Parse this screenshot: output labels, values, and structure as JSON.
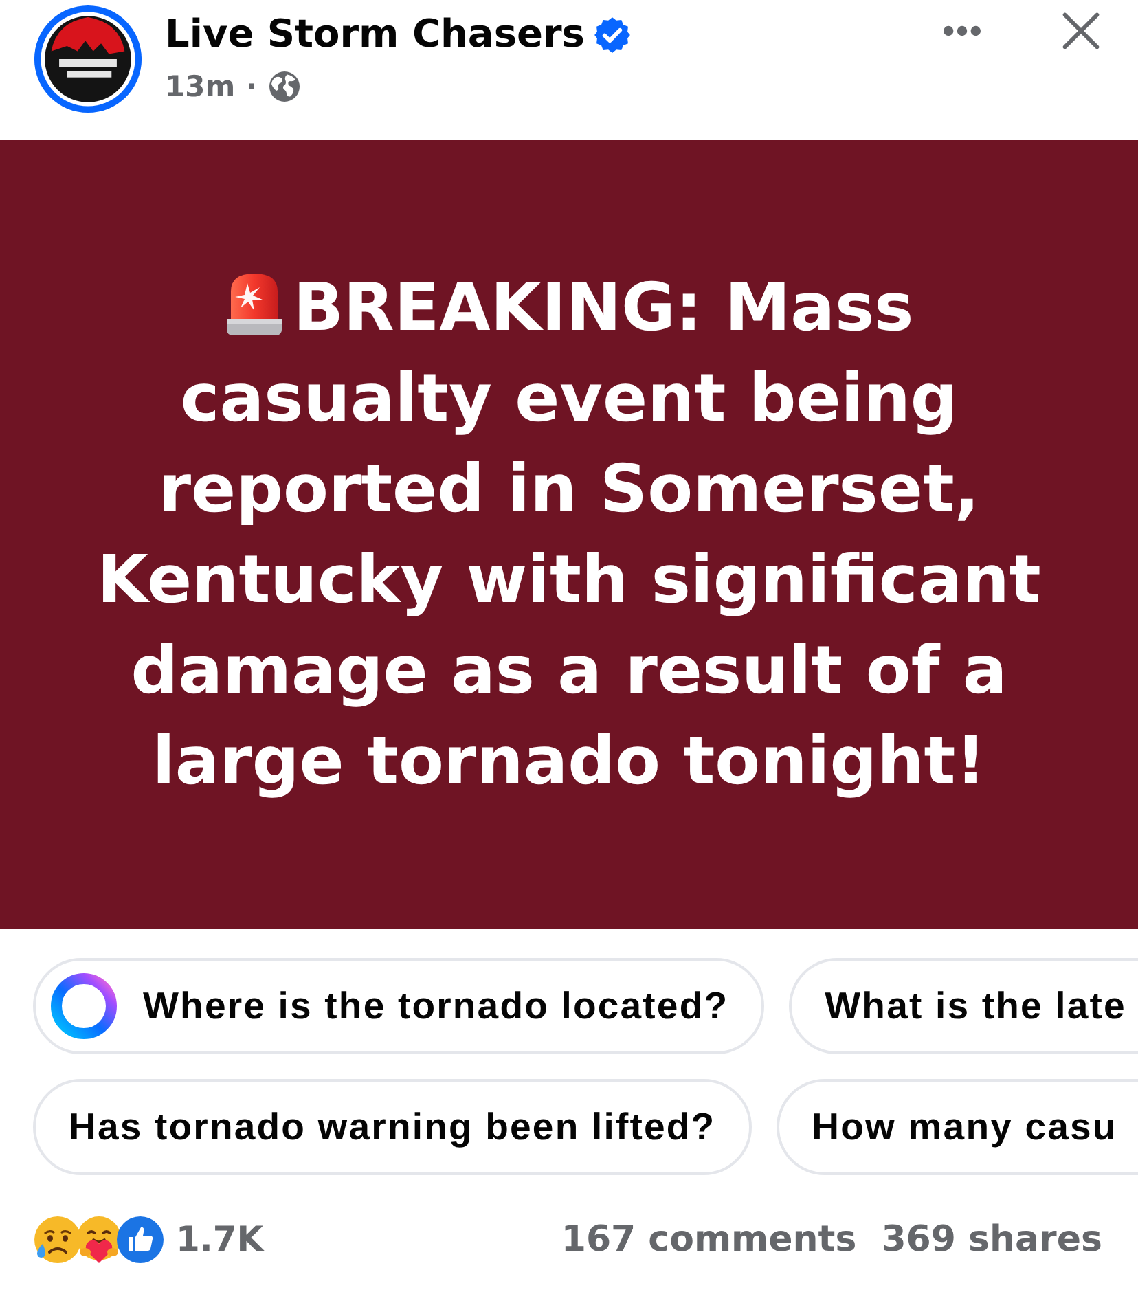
{
  "header": {
    "page_name": "Live Storm Chasers",
    "verified": true,
    "time": "13m",
    "separator": "·"
  },
  "post": {
    "text": "BREAKING: Mass casualty event being reported in Somerset, Kentucky with significant damage as a result of a large tornado tonight!"
  },
  "suggested_questions": [
    {
      "chips": [
        {
          "kind": "ai",
          "text": "Where is the tornado located?"
        },
        {
          "kind": "plain",
          "text": "What is the late"
        }
      ]
    },
    {
      "chips": [
        {
          "kind": "plain",
          "text": "Has tornado warning been lifted?"
        },
        {
          "kind": "plain",
          "text": "How many casu"
        }
      ]
    }
  ],
  "stats": {
    "reactions": "1.7K",
    "comments": "167 comments",
    "shares": "369 shares"
  }
}
